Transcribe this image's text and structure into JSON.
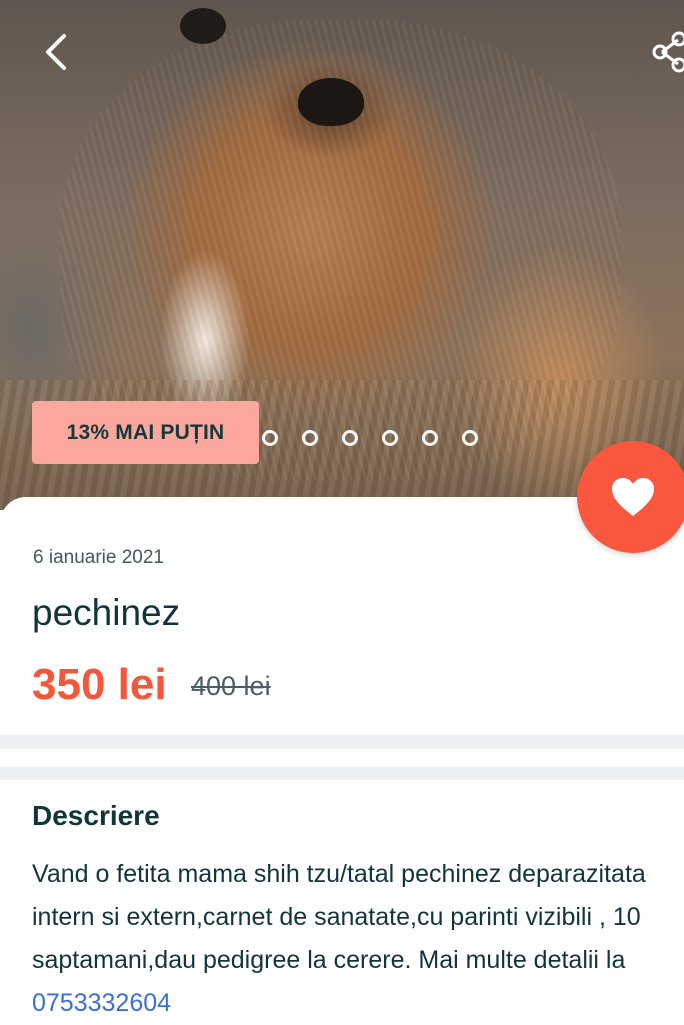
{
  "gallery": {
    "image_alt": "",
    "image_count": 6,
    "active_index": 0
  },
  "badge": {
    "discount_label": "13% MAI PUȚIN"
  },
  "listing": {
    "date": "6 ianuarie 2021",
    "title": "pechinez",
    "price": "350 lei",
    "old_price": "400 lei"
  },
  "description": {
    "heading": "Descriere",
    "text": "Vand o fetita mama shih tzu/tatal pechinez deparazitata intern si extern,carnet de sanatate,cu parinti vizibili , 10 saptamani,dau pedigree la",
    "text_cont": "cerere. Mai multe detalii la",
    "phone": "0753332604"
  },
  "colors": {
    "accent": "#f9583f",
    "price": "#f4573b",
    "badge_bg": "#fba79d",
    "text_dark": "#12353a",
    "link": "#3a6fd8"
  },
  "icons": {
    "back": "chevron-left-icon",
    "share": "share-icon",
    "favorite": "heart-icon"
  }
}
